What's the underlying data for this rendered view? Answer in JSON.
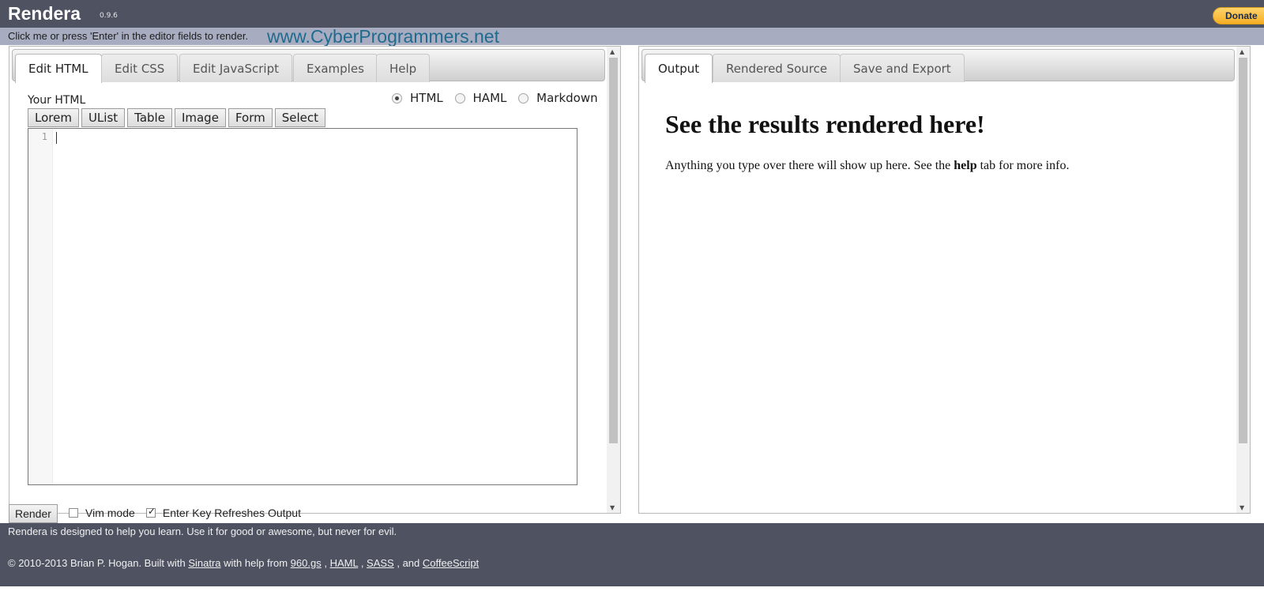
{
  "header": {
    "app_name": "Rendera",
    "version": "0.9.6",
    "donate_label": "Donate"
  },
  "notice": {
    "text": "Click me or press 'Enter' in the editor fields to render.",
    "watermark": "www.CyberProgrammers.net"
  },
  "left_panel": {
    "tabs": [
      "Edit HTML",
      "Edit CSS",
      "Edit JavaScript",
      "Examples",
      "Help"
    ],
    "active_tab": "Edit HTML",
    "section_label": "Your HTML",
    "format_options": [
      "HTML",
      "HAML",
      "Markdown"
    ],
    "selected_format": "HTML",
    "snippet_buttons": [
      "Lorem",
      "UList",
      "Table",
      "Image",
      "Form",
      "Select"
    ],
    "editor": {
      "line_number": "1",
      "value": ""
    }
  },
  "right_panel": {
    "tabs": [
      "Output",
      "Rendered Source",
      "Save and Export"
    ],
    "active_tab": "Output",
    "heading": "See the results rendered here!",
    "paragraph_before": "Anything you type over there will show up here. See the ",
    "paragraph_bold": "help",
    "paragraph_after": " tab for more info."
  },
  "controls": {
    "render_label": "Render",
    "vim_mode_label": "Vim mode",
    "vim_mode_checked": false,
    "enter_refresh_label": "Enter Key Refreshes Output",
    "enter_refresh_checked": true
  },
  "footer": {
    "tagline": "Rendera is designed to help you learn. Use it for good or awesome, but never for evil.",
    "copyright_prefix": "© 2010-2013 Brian P. Hogan. Built with ",
    "sinatra": "Sinatra",
    "with_help": " with help from ",
    "gs960": "960.gs",
    "comma1": " , ",
    "haml": "HAML",
    "comma2": " , ",
    "sass": "SASS",
    "and_text": " , and ",
    "coffeescript": "CoffeeScript"
  },
  "colors": {
    "header_bg": "#4e5261",
    "notice_bg": "#a8acc1",
    "watermark": "#1f6b8e",
    "donate": "#f5ad24"
  }
}
